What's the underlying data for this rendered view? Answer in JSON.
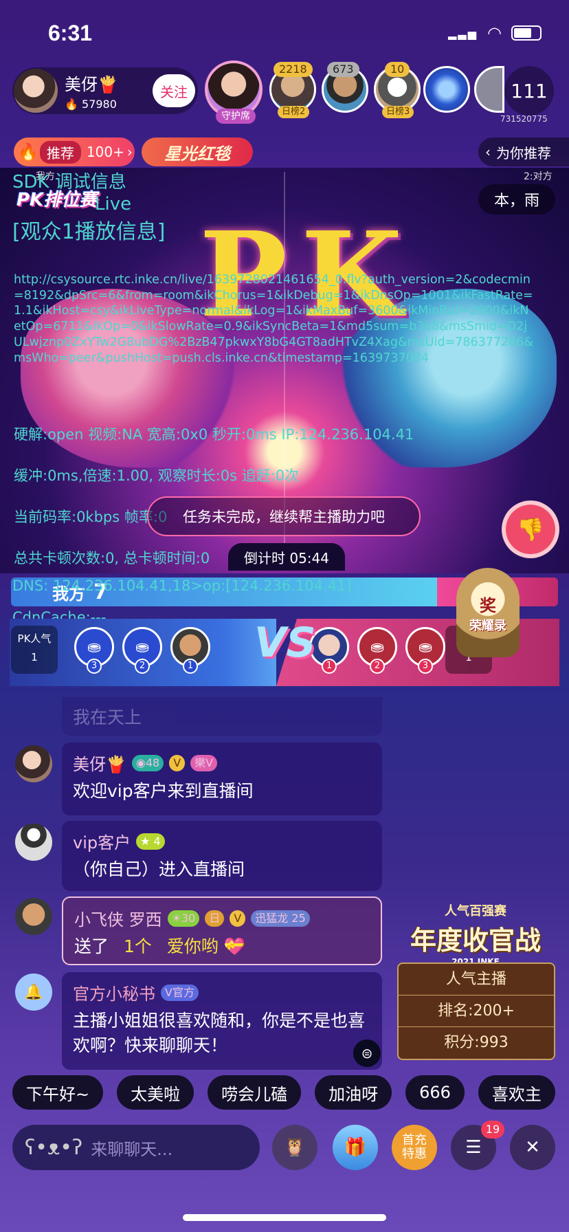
{
  "status_bar": {
    "time": "6:31"
  },
  "host": {
    "name": "美伢🍟",
    "heat": "57980",
    "follow_label": "关注"
  },
  "guardian": {
    "label": "守护席"
  },
  "viewers": [
    {
      "badge": "2218",
      "rank": "日榜2"
    },
    {
      "badge": "673",
      "rank": ""
    },
    {
      "badge": "10",
      "rank": "日榜3"
    }
  ],
  "audience_count": "111",
  "room_id": "731520775",
  "tags": {
    "recommend": "推荐",
    "recommend_count": "100+",
    "event": "星光红毯",
    "for_you": "为你推荐"
  },
  "pk": {
    "title": "PK排位赛",
    "left_label": "我方",
    "right_label_small": "2:对方",
    "opponent_name": "本，雨",
    "letters": "PK",
    "our_score": "7",
    "their_score": "2",
    "left_pop_label": "PK人气",
    "left_pop_value": "1",
    "right_pop_label": "人气",
    "right_pop_value": "1",
    "left_seats": [
      "3",
      "2",
      "1"
    ],
    "right_seats": [
      "1",
      "2",
      "3"
    ],
    "vs": "VS",
    "award": "奖",
    "award_sub": "荣耀录"
  },
  "debug": {
    "title": "SDK 调试信息",
    "live": "Live",
    "section": "[观众1播放信息]",
    "url": "http://csysource.rtc.inke.cn/live/1639728021461654_0.flv?auth_version=2&codecmin=8192&dpSrc=6&from=room&ikChorus=1&ikDebug=1&ikDnsOp=1001&ikFastRate=1.1&ikHost=csy&ikLiveType=normal&ikLog=1&ikMaxBuf=3600&ikMinBuf=2900&ikNetOp=6711&ikOp=0&ikSlowRate=0.9&ikSyncBeta=1&md5sum=b3a8&msSmid=D2jULwjznp0ZxYTw2G8ubDG%2BzB47pkwxY8bG4GT8adHTvZ4Xag&msUid=786377266&msWho=peer&pushHost=push.cls.inke.cn&timestamp=1639737084",
    "hw": "硬解:open 视频:NA 宽高:0x0 秒开:0ms IP:124.236.104.41",
    "buffer": "缓冲:0ms,倍速:1.00, 观察时长:0s 追赶:0次",
    "bitrate": "当前码率:0kbps 帧率:0",
    "stall": "总共卡顿次数:0, 总卡顿时间:0",
    "dns": "DNS: 124.236.104.41,18>op:[124.236.104.41]",
    "cdn": "CdnCache:---"
  },
  "task_text": "任务未完成，继续帮主播助力吧",
  "countdown": "倒计时 05:44",
  "chat": [
    {
      "name": "",
      "text": "我在天上"
    },
    {
      "name": "美伢🍟",
      "level": "48",
      "text": "欢迎vip客户来到直播间"
    },
    {
      "name": "vip客户",
      "level": "4",
      "text": "（你自己）进入直播间"
    },
    {
      "name": "小飞侠 罗西",
      "level": "30",
      "extra": "迅猛龙",
      "extra_lv": "25",
      "text": "送了",
      "gift_count": "1个",
      "gift_name": "爱你哟"
    },
    {
      "name": "官方小秘书",
      "tag": "官方",
      "text": "主播小姐姐很喜欢随和，你是不是也喜欢啊？快来聊聊天！"
    }
  ],
  "side": {
    "event": "人气百强赛",
    "title": "年度收官战",
    "year": "2021 INKE",
    "rows": [
      "人气主播",
      "排名:200+",
      "积分:993"
    ]
  },
  "quick_replies": [
    "下午好~",
    "太美啦",
    "唠会儿磕",
    "加油呀",
    "666",
    "喜欢主"
  ],
  "input": {
    "placeholder": "来聊聊天..."
  },
  "bottom": {
    "first_charge": "首充",
    "first_charge2": "特惠",
    "menu_badge": "19"
  }
}
